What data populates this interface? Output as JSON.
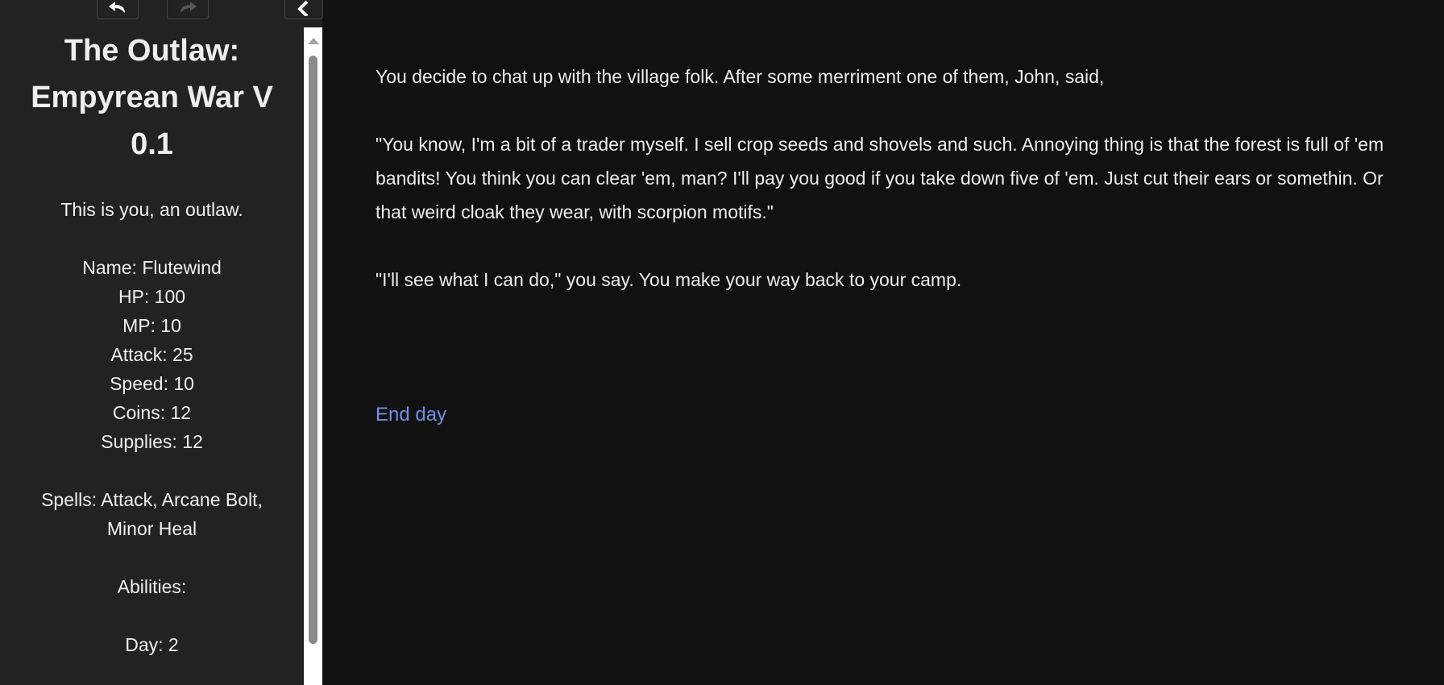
{
  "sidebar": {
    "nav": {
      "back_icon": "undo-arrow-icon",
      "forward_icon": "redo-arrow-icon",
      "collapse_icon": "chevron-left-icon"
    },
    "title": "The Outlaw: Empyrean War V 0.1",
    "intro": "This is you, an outlaw.",
    "stats": {
      "name": "Name: Flutewind",
      "hp": "HP: 100",
      "mp": "MP: 10",
      "attack": "Attack: 25",
      "speed": "Speed: 10",
      "coins": "Coins: 12",
      "supplies": "Supplies: 12"
    },
    "spells": "Spells: Attack, Arcane Bolt, Minor Heal",
    "abilities": "Abilities:",
    "day": "Day: 2"
  },
  "passage": {
    "paragraphs": [
      "You decide to chat up with the village folk. After some merriment one of them, John, said,",
      "\"You know, I'm a bit of a trader myself. I sell crop seeds and shovels and such. Annoying thing is that the forest is full of 'em bandits! You think you can clear 'em, man? I'll pay you good if you take down five of 'em. Just cut their ears or somethin. Or that weird cloak they wear, with scorpion motifs.\"",
      "\"I'll see what I can do,\" you say. You make your way back to your camp."
    ],
    "link": "End day"
  },
  "colors": {
    "background": "#111111",
    "sidebar": "#222222",
    "text": "#eeeeee",
    "link": "#6f8fe6"
  }
}
